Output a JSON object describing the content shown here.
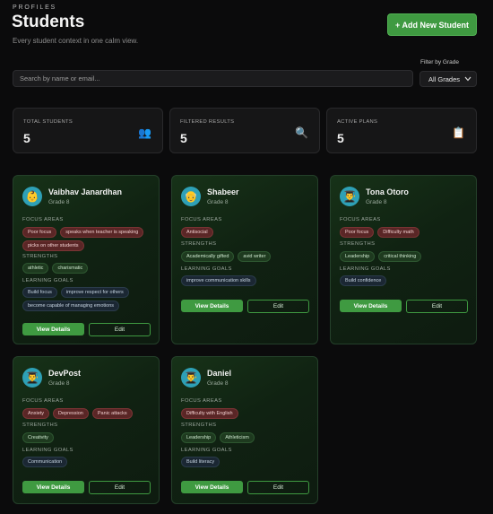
{
  "header": {
    "eyebrow": "PROFILES",
    "title": "Students",
    "subtitle": "Every student context in one calm view.",
    "add_button": "+ Add New Student"
  },
  "search": {
    "placeholder": "Search by name or email..."
  },
  "filter": {
    "label": "Filter by Grade",
    "selected": "All Grades"
  },
  "stats": [
    {
      "label": "TOTAL STUDENTS",
      "value": "5",
      "icon": "people-icon"
    },
    {
      "label": "FILTERED RESULTS",
      "value": "5",
      "icon": "magnifier-icon"
    },
    {
      "label": "ACTIVE PLANS",
      "value": "5",
      "icon": "clipboard-icon"
    }
  ],
  "section_labels": {
    "focus": "FOCUS AREAS",
    "strengths": "STRENGTHS",
    "goals": "LEARNING GOALS"
  },
  "buttons": {
    "view": "View Details",
    "edit": "Edit"
  },
  "colors": {
    "accent": "#3f9a41",
    "focus_tag": "#5a2626",
    "strength_tag": "#1e3a1f",
    "goal_tag": "#1b2733"
  },
  "students": [
    {
      "name": "Vaibhav Janardhan",
      "grade": "Grade 8",
      "avatar": "👶",
      "focus": [
        "Poor focus",
        "speaks when teacher is speaking",
        "picks on other students"
      ],
      "strengths": [
        "athletic",
        "charismatic"
      ],
      "goals": [
        "Build focus",
        "improve respect for others",
        "become capable of managing emotions"
      ]
    },
    {
      "name": "Shabeer",
      "grade": "Grade 8",
      "avatar": "👴",
      "focus": [
        "Antisocial"
      ],
      "strengths": [
        "Academically gifted",
        "avid writer"
      ],
      "goals": [
        "improve communication skills"
      ]
    },
    {
      "name": "Tona Otoro",
      "grade": "Grade 8",
      "avatar": "👨‍🎓",
      "focus": [
        "Poor focus",
        "Difficulty math"
      ],
      "strengths": [
        "Leadership",
        "critical thinking"
      ],
      "goals": [
        "Build confidence"
      ]
    },
    {
      "name": "DevPost",
      "grade": "Grade 8",
      "avatar": "👨‍🎓",
      "focus": [
        "Anxiety",
        "Depression",
        "Panic attacks"
      ],
      "strengths": [
        "Creativity"
      ],
      "goals": [
        "Communication"
      ]
    },
    {
      "name": "Daniel",
      "grade": "Grade 8",
      "avatar": "👨‍🎓",
      "focus": [
        "Difficulty with English"
      ],
      "strengths": [
        "Leadership",
        "Athleticism"
      ],
      "goals": [
        "Build literacy"
      ]
    }
  ]
}
